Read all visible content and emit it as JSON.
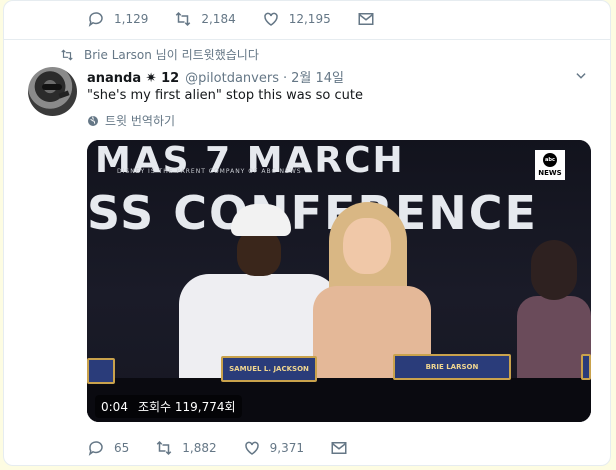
{
  "top_actions": {
    "replies": "1,129",
    "retweets": "2,184",
    "likes": "12,195"
  },
  "retweet_notice": "Brie Larson 님이 리트윗했습니다",
  "tweet": {
    "display_name": "ananda ✷ 12",
    "handle": "@pilotdanvers",
    "separator": "·",
    "date": "2월 14일",
    "text": "\"she's my first alien\" stop this was so cute",
    "translate_label": "트윗 번역하기"
  },
  "video": {
    "banner_line1": "MAS 7 MARCH",
    "banner_small": "DISNEY IS THE PARENT COMPANY OF ABC NEWS",
    "banner_line2": "SS CONFERENCE",
    "logo_top": "abc",
    "logo_bottom": "NEWS",
    "nameplate_left": "SAMUEL L. JACKSON",
    "nameplate_right": "BRIE LARSON",
    "duration": "0:04",
    "views": "조회수 119,774회"
  },
  "bottom_actions": {
    "replies": "65",
    "retweets": "1,882",
    "likes": "9,371"
  },
  "colors": {
    "muted": "#657786",
    "text": "#14171a",
    "page_bg": "#fdfce2"
  }
}
